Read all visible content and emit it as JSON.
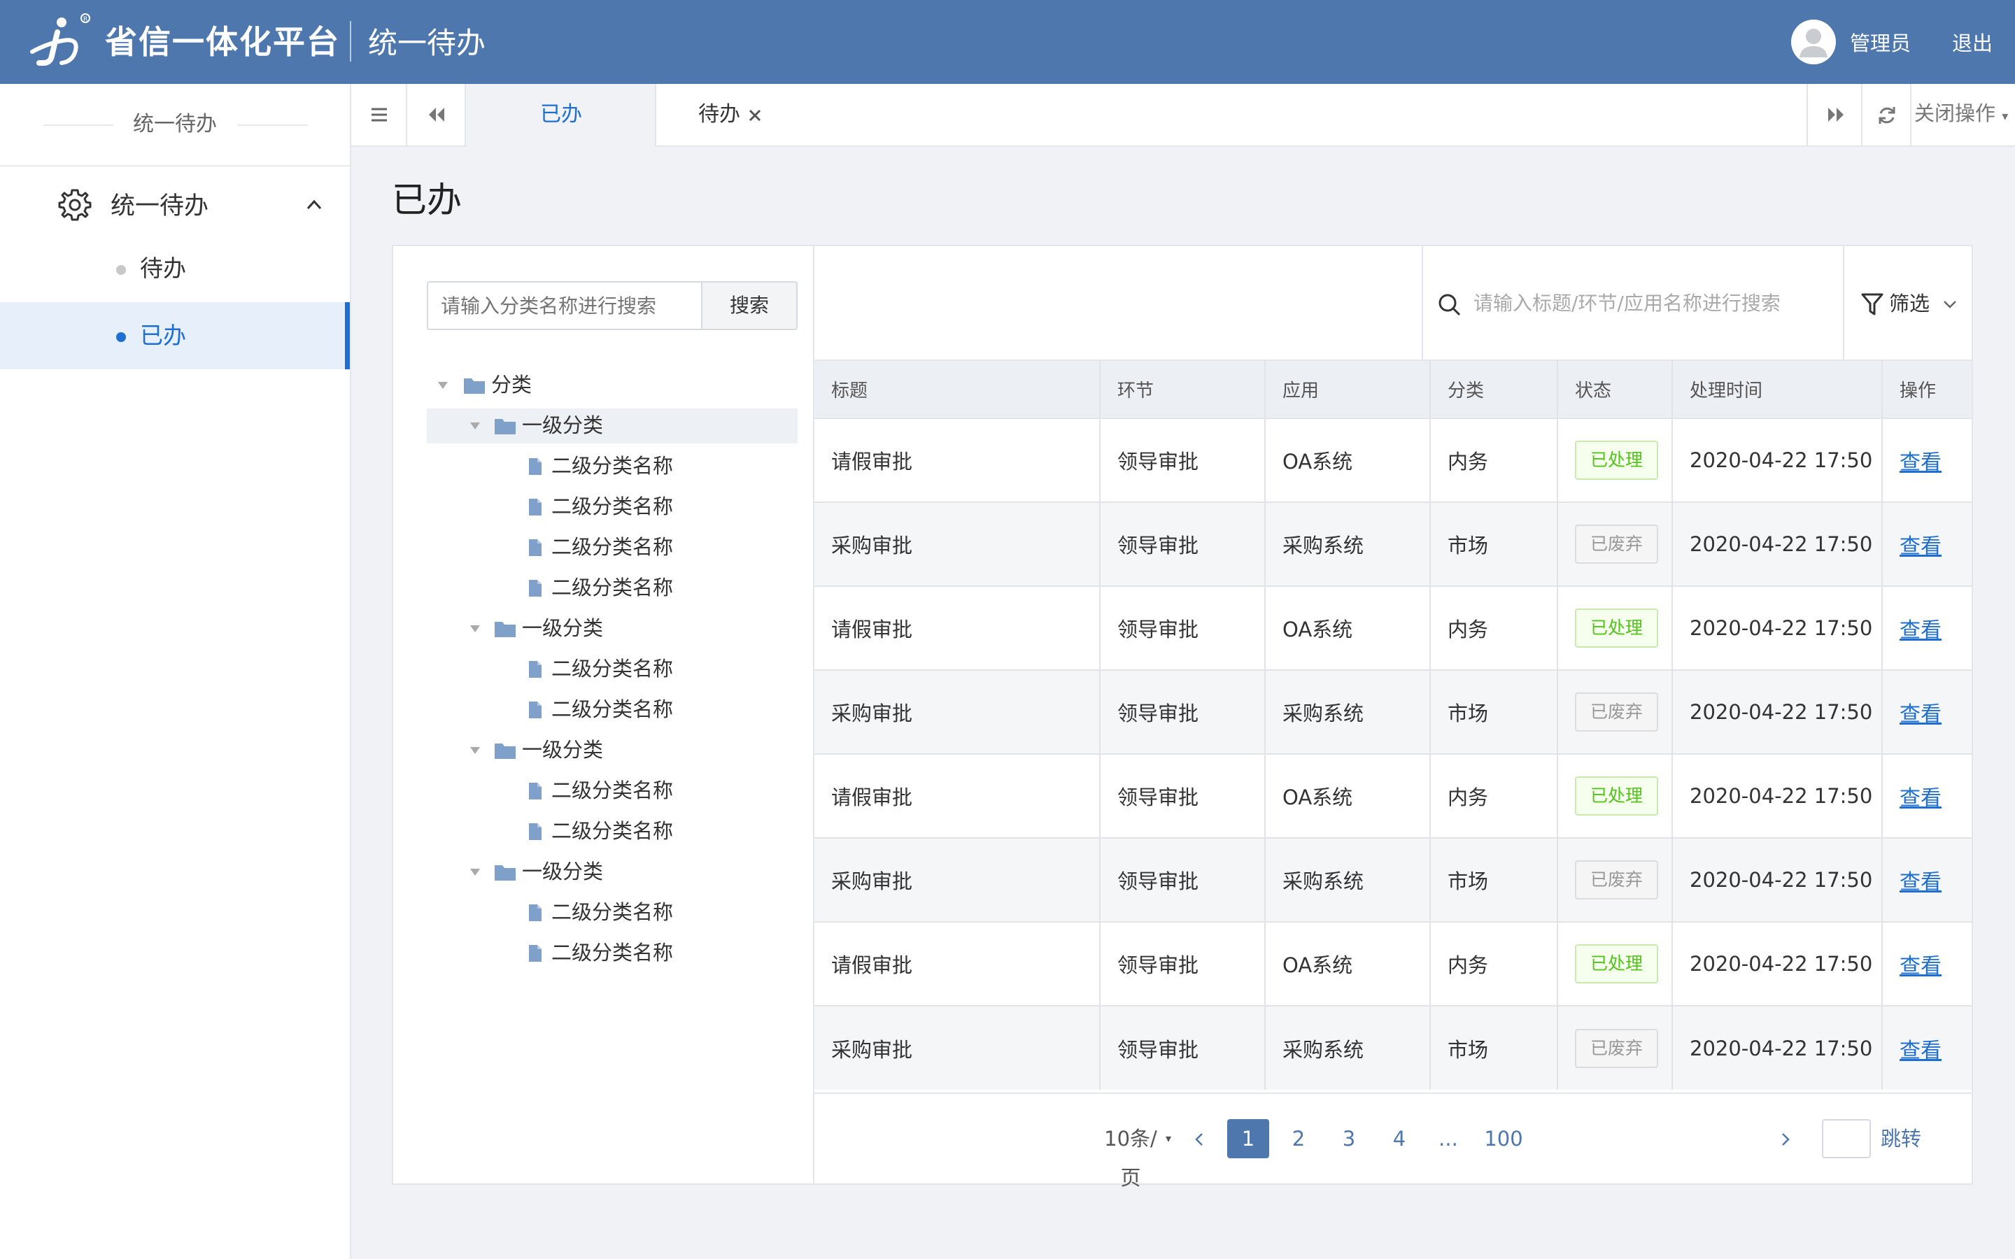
{
  "header": {
    "brand": "省信一体化平台",
    "subtitle": "统一待办",
    "username": "管理员",
    "logout": "退出"
  },
  "sidebar": {
    "section_title": "统一待办",
    "group_label": "统一待办",
    "items": [
      {
        "label": "待办",
        "active": false
      },
      {
        "label": "已办",
        "active": true
      }
    ]
  },
  "tabs": {
    "items": [
      {
        "label": "已办",
        "active": true
      },
      {
        "label": "待办",
        "active": false,
        "closable": true
      }
    ],
    "close_ops": "关闭操作"
  },
  "page": {
    "title": "已办"
  },
  "category_panel": {
    "search_placeholder": "请输入分类名称进行搜索",
    "search_button": "搜索",
    "tree": {
      "root": "分类",
      "groups": [
        {
          "label": "一级分类",
          "children": [
            "二级分类名称",
            "二级分类名称",
            "二级分类名称",
            "二级分类名称"
          ]
        },
        {
          "label": "一级分类",
          "children": [
            "二级分类名称",
            "二级分类名称"
          ]
        },
        {
          "label": "一级分类",
          "children": [
            "二级分类名称",
            "二级分类名称"
          ]
        },
        {
          "label": "一级分类",
          "children": [
            "二级分类名称",
            "二级分类名称"
          ]
        }
      ]
    }
  },
  "list_panel": {
    "search_placeholder": "请输入标题/环节/应用名称进行搜索",
    "filter_label": "筛选",
    "columns": [
      "标题",
      "环节",
      "应用",
      "分类",
      "状态",
      "处理时间",
      "操作"
    ],
    "rows": [
      {
        "title": "请假审批",
        "step": "领导审批",
        "app": "OA系统",
        "category": "内务",
        "status": "已处理",
        "status_type": "ok",
        "time": "2020-04-22 17:50",
        "action": "查看"
      },
      {
        "title": "采购审批",
        "step": "领导审批",
        "app": "采购系统",
        "category": "市场",
        "status": "已废弃",
        "status_type": "off",
        "time": "2020-04-22 17:50",
        "action": "查看"
      },
      {
        "title": "请假审批",
        "step": "领导审批",
        "app": "OA系统",
        "category": "内务",
        "status": "已处理",
        "status_type": "ok",
        "time": "2020-04-22 17:50",
        "action": "查看"
      },
      {
        "title": "采购审批",
        "step": "领导审批",
        "app": "采购系统",
        "category": "市场",
        "status": "已废弃",
        "status_type": "off",
        "time": "2020-04-22 17:50",
        "action": "查看"
      },
      {
        "title": "请假审批",
        "step": "领导审批",
        "app": "OA系统",
        "category": "内务",
        "status": "已处理",
        "status_type": "ok",
        "time": "2020-04-22 17:50",
        "action": "查看"
      },
      {
        "title": "采购审批",
        "step": "领导审批",
        "app": "采购系统",
        "category": "市场",
        "status": "已废弃",
        "status_type": "off",
        "time": "2020-04-22 17:50",
        "action": "查看"
      },
      {
        "title": "请假审批",
        "step": "领导审批",
        "app": "OA系统",
        "category": "内务",
        "status": "已处理",
        "status_type": "ok",
        "time": "2020-04-22 17:50",
        "action": "查看"
      },
      {
        "title": "采购审批",
        "step": "领导审批",
        "app": "采购系统",
        "category": "市场",
        "status": "已废弃",
        "status_type": "off",
        "time": "2020-04-22 17:50",
        "action": "查看"
      }
    ]
  },
  "pagination": {
    "page_size": "10条/页",
    "pages": [
      "1",
      "2",
      "3",
      "4",
      "...",
      "100"
    ],
    "current": "1",
    "jump_label": "跳转"
  },
  "colors": {
    "header_bg": "#4d77ad",
    "accent": "#1f6fd1",
    "success": "#52c41a",
    "muted": "#999999"
  }
}
